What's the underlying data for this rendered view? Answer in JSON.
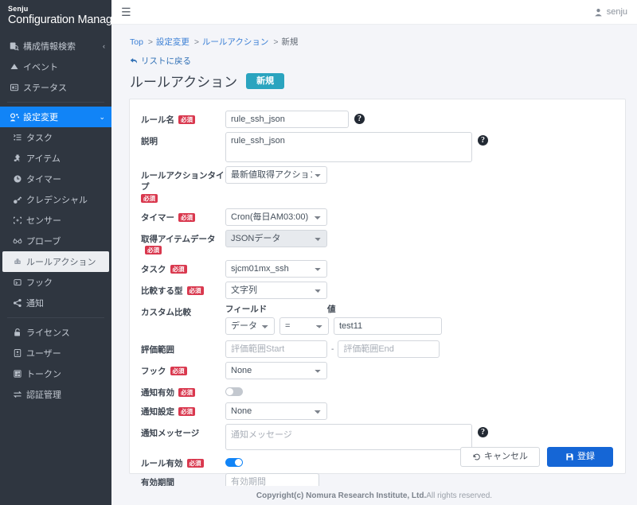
{
  "brand": {
    "top": "Senju",
    "main": "Configuration Manager"
  },
  "sidebar": {
    "items": [
      {
        "label": "構成情報検索",
        "icon": "search-db-icon",
        "type": "top",
        "chevron": "‹"
      },
      {
        "label": "イベント",
        "icon": "event-icon",
        "type": "top"
      },
      {
        "label": "ステータス",
        "icon": "status-icon",
        "type": "top"
      },
      {
        "label": "設定変更",
        "icon": "settings-icon",
        "type": "top",
        "active": true,
        "chevron": "⌄"
      },
      {
        "label": "タスク",
        "icon": "task-icon",
        "type": "sub"
      },
      {
        "label": "アイテム",
        "icon": "item-icon",
        "type": "sub"
      },
      {
        "label": "タイマー",
        "icon": "timer-icon",
        "type": "sub"
      },
      {
        "label": "クレデンシャル",
        "icon": "credential-icon",
        "type": "sub"
      },
      {
        "label": "センサー",
        "icon": "sensor-icon",
        "type": "sub"
      },
      {
        "label": "プローブ",
        "icon": "probe-icon",
        "type": "sub"
      },
      {
        "label": "ルールアクション",
        "icon": "rule-action-icon",
        "type": "sub",
        "selected": true
      },
      {
        "label": "フック",
        "icon": "hook-icon",
        "type": "sub"
      },
      {
        "label": "通知",
        "icon": "notify-icon",
        "type": "sub"
      },
      {
        "label": "ライセンス",
        "icon": "license-icon",
        "type": "sub"
      },
      {
        "label": "ユーザー",
        "icon": "user-icon",
        "type": "sub"
      },
      {
        "label": "トークン",
        "icon": "token-icon",
        "type": "sub"
      },
      {
        "label": "認証管理",
        "icon": "auth-icon",
        "type": "sub"
      }
    ]
  },
  "topbar": {
    "menu_icon": "hamburger-icon",
    "user_icon": "person-icon",
    "user_name": "senju"
  },
  "breadcrumb": {
    "items": [
      "Top",
      "設定変更",
      "ルールアクション",
      "新規"
    ],
    "separator": ">"
  },
  "back_link": {
    "label": "リストに戻る",
    "icon": "back-arrow-icon"
  },
  "page": {
    "title": "ルールアクション",
    "badge": "新規"
  },
  "required_badge": "必須",
  "form": {
    "rule_name": {
      "label": "ルール名",
      "value": "rule_ssh_json"
    },
    "description": {
      "label": "説明",
      "value": "rule_ssh_json"
    },
    "rule_action_type": {
      "label": "ルールアクションタイプ",
      "value": "最新値取得アクション"
    },
    "timer": {
      "label": "タイマー",
      "value": "Cron(毎日AM03:00)"
    },
    "item_data": {
      "label": "取得アイテムデータ",
      "value": "JSONデータ"
    },
    "task": {
      "label": "タスク",
      "value": "sjcm01mx_ssh"
    },
    "compare_type": {
      "label": "比較する型",
      "value": "文字列"
    },
    "custom_compare": {
      "label": "カスタム比較",
      "field_header": "フィールド",
      "value_header": "値",
      "field_value": "データ",
      "operator_value": "=",
      "text_value": "test11"
    },
    "eval_range": {
      "label": "評価範囲",
      "start_placeholder": "評価範囲Start",
      "end_placeholder": "評価範囲End",
      "separator": "-"
    },
    "hook": {
      "label": "フック",
      "value": "None"
    },
    "notify_enabled": {
      "label": "通知有効",
      "state": "off"
    },
    "notify_setting": {
      "label": "通知設定",
      "value": "None"
    },
    "notify_message": {
      "label": "通知メッセージ",
      "placeholder": "通知メッセージ"
    },
    "rule_enabled": {
      "label": "ルール有効",
      "state": "on"
    },
    "valid_period": {
      "label": "有効期間",
      "placeholder": "有効期間"
    }
  },
  "buttons": {
    "cancel": "キャンセル",
    "save": "登録"
  },
  "footer": {
    "copyright_bold": "Copyright(c) Nomura Research Institute, Ltd.",
    "copyright_rest": " All rights reserved."
  },
  "colors": {
    "sidebar_bg": "#2f3640",
    "accent_blue": "#1184f7",
    "badge_teal": "#2aa4bf",
    "required_red": "#d9384e",
    "save_blue": "#1566d6"
  }
}
